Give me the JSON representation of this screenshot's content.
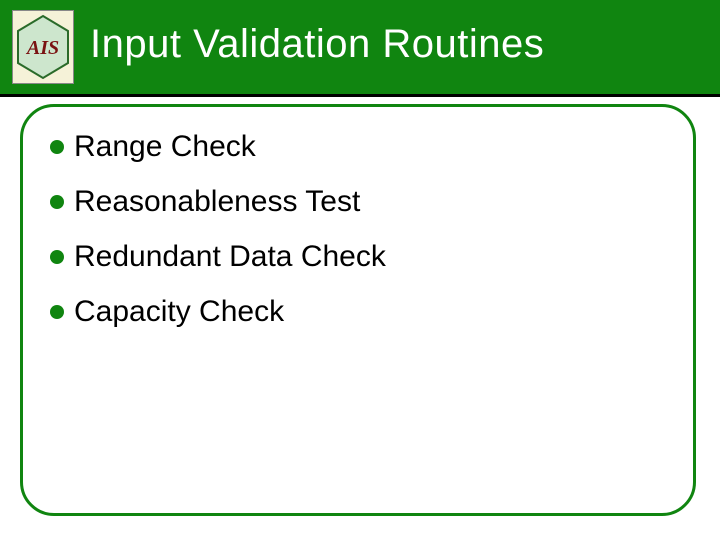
{
  "title": "Input Validation Routines",
  "logo": {
    "name": "ais-logo",
    "letters": "AIS"
  },
  "bullets": [
    {
      "text": "Range Check"
    },
    {
      "text": "Reasonableness Test"
    },
    {
      "text": "Redundant Data Check"
    },
    {
      "text": "Capacity Check"
    }
  ]
}
